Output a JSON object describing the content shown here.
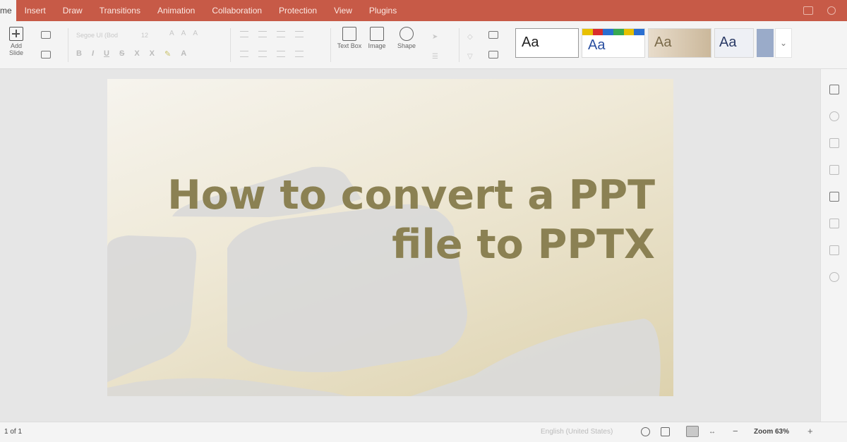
{
  "menubar": {
    "first_tab_fragment": "me",
    "tabs": [
      "Insert",
      "Draw",
      "Transitions",
      "Animation",
      "Collaboration",
      "Protection",
      "View",
      "Plugins"
    ]
  },
  "ribbon": {
    "add_slide_label": "Add Slide",
    "font_name": "Segoe UI (Bod",
    "font_size": "12",
    "text_box_label": "Text Box",
    "image_label": "Image",
    "shape_label": "Shape",
    "theme_sample": "Aa"
  },
  "slide": {
    "title_line1": "How to convert a PPT",
    "title_line2": "file to PPTX"
  },
  "statusbar": {
    "page_indicator": "1 of 1",
    "language": "English (United States)",
    "zoom_label": "Zoom 63%",
    "minus": "−",
    "plus": "+"
  },
  "colors": {
    "menubar_bg": "#c75a47",
    "title_color": "#8b8153"
  }
}
